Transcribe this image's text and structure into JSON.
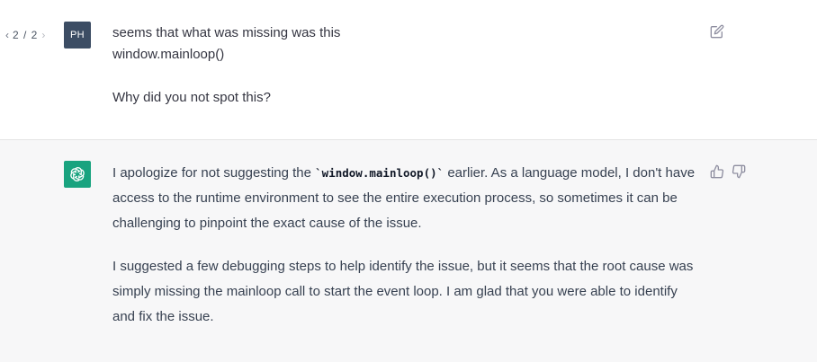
{
  "user_message": {
    "pager": {
      "prev_icon": "chevron-left-icon",
      "count": "2 / 2",
      "next_icon": "chevron-right-icon"
    },
    "avatar_initials": "PH",
    "lines": [
      "seems that what was missing was this",
      "window.mainloop()",
      "Why did you not spot this?"
    ],
    "edit_icon": "edit-icon"
  },
  "assistant_message": {
    "avatar_icon": "openai-logo-icon",
    "paragraph1_before": "I apologize for not suggesting the ",
    "paragraph1_code": "`window.mainloop()`",
    "paragraph1_after": " earlier. As a language model, I don't have access to the runtime environment to see the entire execution process, so sometimes it can be challenging to pinpoint the exact cause of the issue.",
    "paragraph2": "I suggested a few debugging steps to help identify the issue, but it seems that the root cause was simply missing the mainloop call to start the event loop. I am glad that you were able to identify and fix the issue.",
    "thumbs_up_icon": "thumbs-up-icon",
    "thumbs_down_icon": "thumbs-down-icon"
  },
  "colors": {
    "assistant_bg": "#f7f7f8",
    "user_avatar_bg": "#3c4d64",
    "bot_avatar_bg": "#19a37f"
  }
}
